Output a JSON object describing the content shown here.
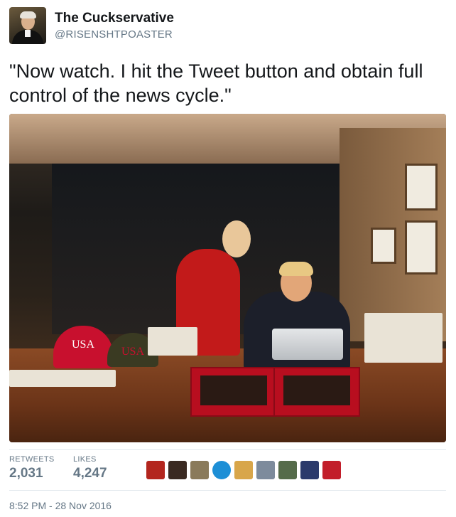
{
  "tweet": {
    "author_name": "The Cuckservative",
    "author_handle": "@RISENSHTPOASTER",
    "text": "\"Now watch. I hit the Tweet button and obtain full control of the news cycle.\"",
    "photo": {
      "hat_left_text": "USA",
      "hat_right_text": "USA"
    }
  },
  "stats": {
    "retweets_label": "RETWEETS",
    "retweets_count": "2,031",
    "likes_label": "LIKES",
    "likes_count": "4,247"
  },
  "liker_avatars": [
    {
      "icon": "avatar-red-image",
      "color": "#b3261e"
    },
    {
      "icon": "avatar-dark-portrait",
      "color": "#3a2a22"
    },
    {
      "icon": "avatar-sketch",
      "color": "#8a7a5a"
    },
    {
      "icon": "avatar-blue-ring",
      "color": "#1d8fd6"
    },
    {
      "icon": "avatar-dog",
      "color": "#d8a64a"
    },
    {
      "icon": "avatar-portrait-man",
      "color": "#7d8b9c"
    },
    {
      "icon": "avatar-crowd",
      "color": "#556b4a"
    },
    {
      "icon": "avatar-pixel-character",
      "color": "#2b3a6b"
    },
    {
      "icon": "avatar-red-orb",
      "color": "#c21e2a"
    }
  ],
  "timestamp": "8:52 PM - 28 Nov 2016"
}
